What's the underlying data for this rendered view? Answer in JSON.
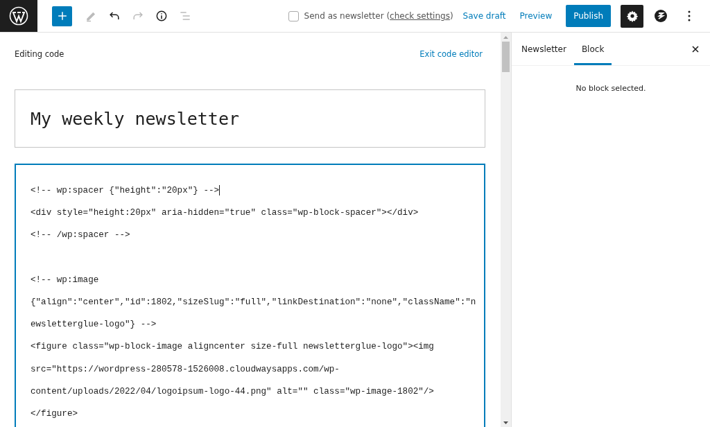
{
  "toolbar": {
    "tools": [
      {
        "kind": "inserter"
      },
      {
        "kind": "edit",
        "disabled": true
      },
      {
        "kind": "undo",
        "disabled": false
      },
      {
        "kind": "redo",
        "disabled": true
      },
      {
        "kind": "details",
        "disabled": false
      },
      {
        "kind": "outline",
        "disabled": true
      }
    ],
    "newsletter": {
      "label": "Send as newsletter",
      "before": "(",
      "link": "check settings",
      "after": ")",
      "checked": false
    },
    "save_draft": "Save draft",
    "preview": "Preview",
    "publish": "Publish",
    "settings_pressed": true
  },
  "editor": {
    "heading": "Editing code",
    "exit": "Exit code editor",
    "title": "My weekly newsletter",
    "code_blocks": [
      [
        "<!-- wp:spacer {\"height\":\"20px\"} -->",
        "<div style=\"height:20px\" aria-hidden=\"true\" class=\"wp-block-spacer\"></div>",
        "<!-- /wp:spacer -->"
      ],
      [
        "<!-- wp:image",
        "{\"align\":\"center\",\"id\":1802,\"sizeSlug\":\"full\",\"linkDestination\":\"none\",\"className\":\"n",
        "ewsletterglue-logo\"} -->",
        "<figure class=\"wp-block-image aligncenter size-full newsletterglue-logo\"><img",
        "src=\"https://wordpress-280578-1526008.cloudwaysapps.com/wp-",
        "content/uploads/2022/04/logoipsum-logo-44.png\" alt=\"\" class=\"wp-image-1802\"/>",
        "</figure>"
      ]
    ]
  },
  "sidebar": {
    "tabs": [
      {
        "label": "Newsletter",
        "selected": false
      },
      {
        "label": "Block",
        "selected": true
      }
    ],
    "message": "No block selected."
  }
}
